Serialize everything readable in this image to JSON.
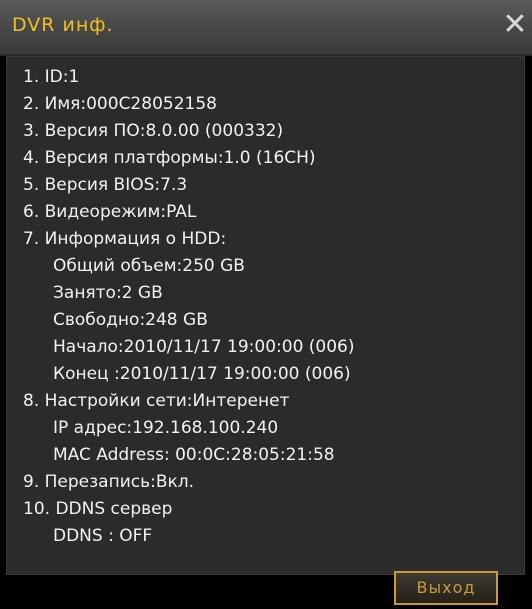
{
  "window": {
    "title": "DVR инф.",
    "close_icon": "close-icon",
    "close_glyph": "✕"
  },
  "info": {
    "lines": [
      "1. ID:1",
      "2. Имя:000C28052158",
      "3. Версия ПО:8.0.00 (000332)",
      "4. Версия платформы:1.0 (16CH)",
      "5. Версия BIOS:7.3",
      "6. Видеорежим:PAL",
      "7. Информация о HDD:",
      "Общий объем:250 GB",
      "Занято:2 GB",
      "Свободно:248 GB",
      "Начало:2010/11/17 19:00:00 (006)",
      "Конец :2010/11/17 19:00:00 (006)",
      "8. Настройки сети:Интеренет",
      "IP адрес:192.168.100.240",
      "MAC Address: 00:0C:28:05:21:58",
      "9. Перезапись:Вкл.",
      "10. DDNS сервер",
      "DDNS : OFF"
    ]
  },
  "footer": {
    "exit_label": "Выход"
  },
  "colors": {
    "title_text": "#f0c020",
    "button_border": "#c89a38",
    "panel_background": "#2b2b2b"
  }
}
